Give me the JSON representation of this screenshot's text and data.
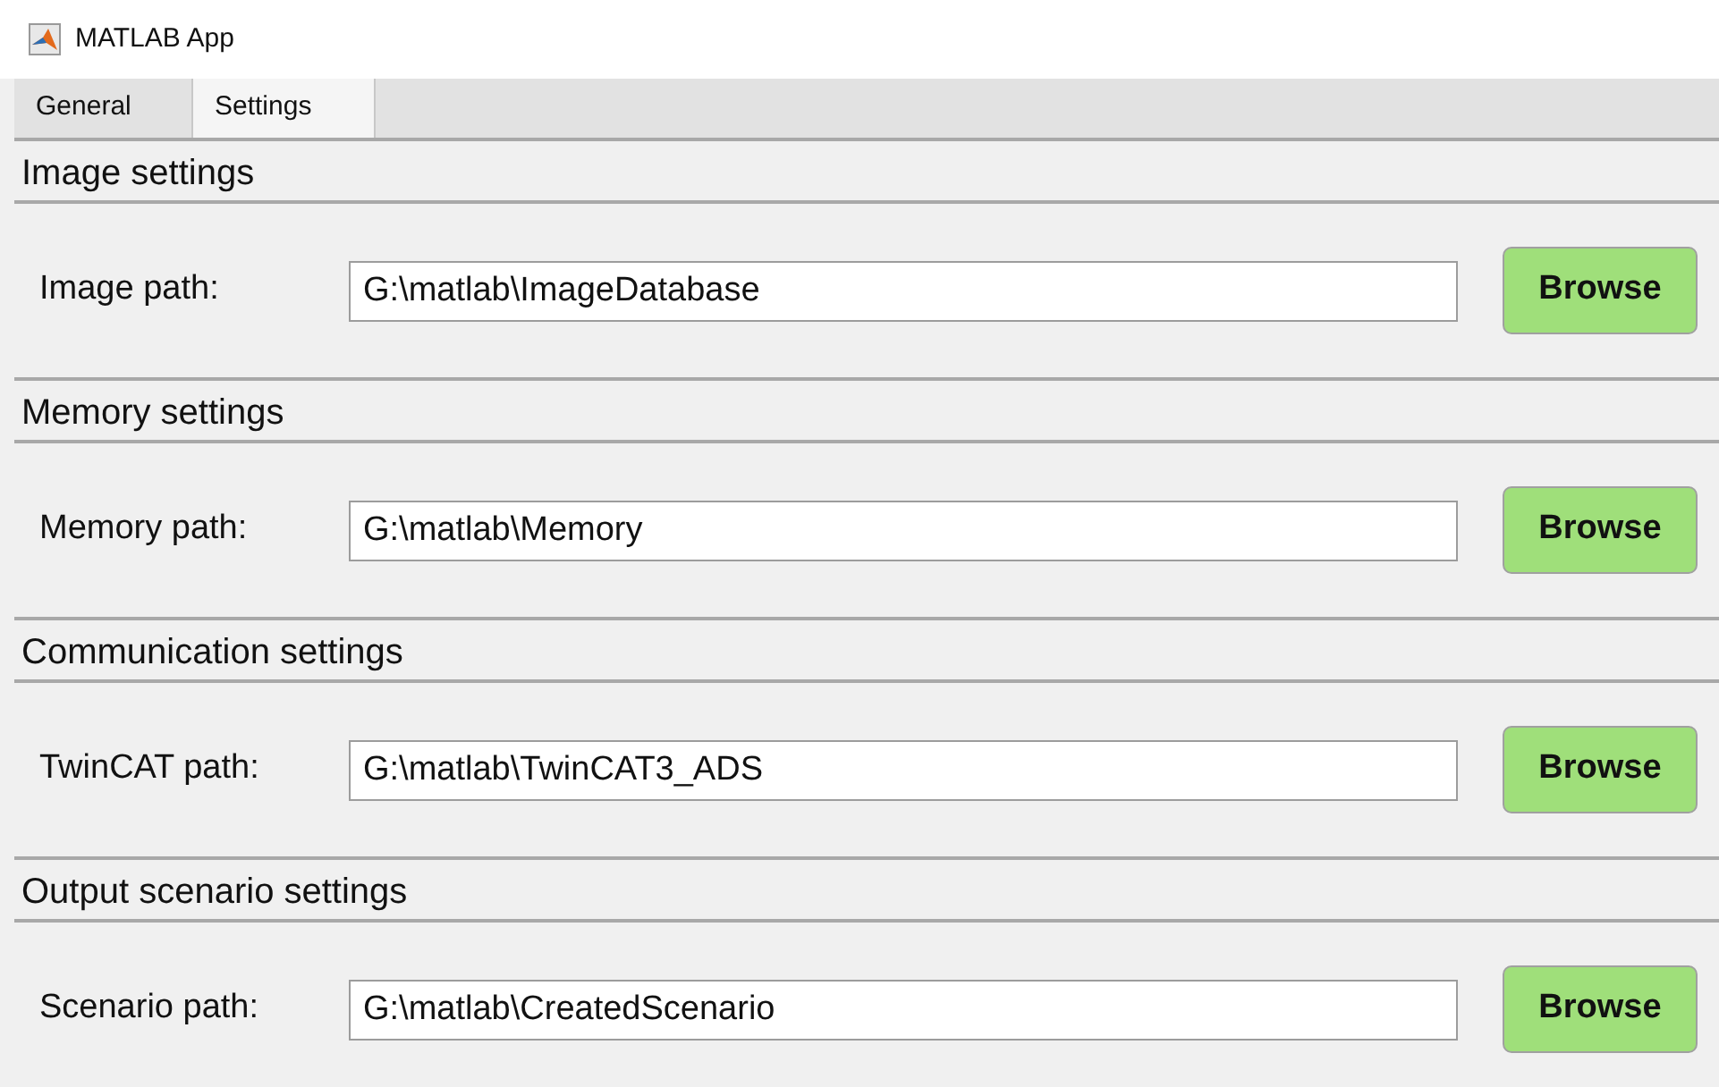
{
  "window": {
    "title": "MATLAB App"
  },
  "tabs": [
    {
      "label": "General",
      "selected": false
    },
    {
      "label": "Settings",
      "selected": true
    }
  ],
  "panels": [
    {
      "title": "Image settings",
      "label": "Image path:",
      "value": "G:\\matlab\\ImageDatabase",
      "button": "Browse"
    },
    {
      "title": "Memory settings",
      "label": "Memory path:",
      "value": "G:\\matlab\\Memory",
      "button": "Browse"
    },
    {
      "title": "Communication settings",
      "label": "TwinCAT path:",
      "value": "G:\\matlab\\TwinCAT3_ADS",
      "button": "Browse"
    },
    {
      "title": "Output scenario settings",
      "label": "Scenario path:",
      "value": "G:\\matlab\\CreatedScenario",
      "button": "Browse"
    }
  ]
}
